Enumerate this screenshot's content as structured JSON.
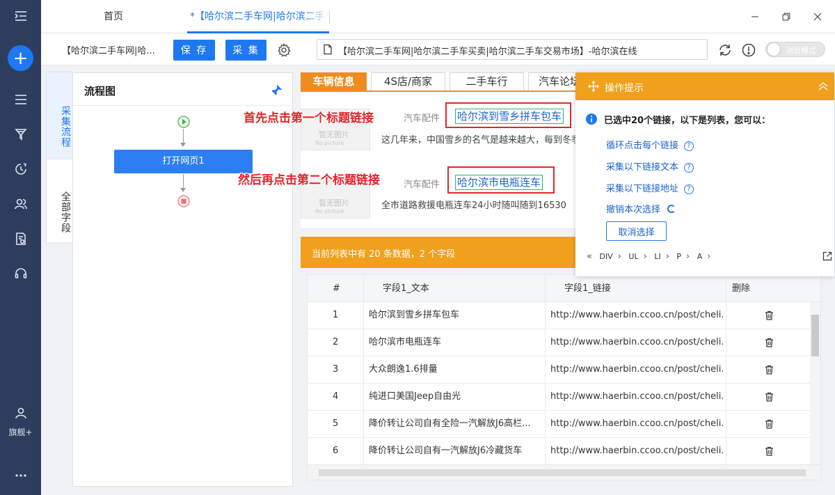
{
  "window": {
    "tabs": [
      {
        "label": "首页"
      },
      {
        "label": "*【哈尔滨二手车网|哈尔滨二手车买卖|哈尔滨二手车交易市场】-哈尔滨在线"
      }
    ]
  },
  "sidebar": {
    "user_label": "旗舰+",
    "icons": [
      "menu-collapse-icon",
      "add-icon",
      "list-icon",
      "funnel-icon",
      "clock-icon",
      "users-icon",
      "document-icon",
      "headset-icon",
      "user-icon",
      "more-icon"
    ]
  },
  "toolbar": {
    "task_name": "【哈尔滨二手车网|哈...",
    "save_label": "保 存",
    "collect_label": "采 集",
    "url": "【哈尔滨二手车网|哈尔滨二手车买卖|哈尔滨二手车交易市场】-哈尔滨在线",
    "browse_mode_label": "浏览模式"
  },
  "vtabs": {
    "flow": "采集流程",
    "fields": "全部字段"
  },
  "flowchart": {
    "title": "流程图",
    "node": "打开网页1"
  },
  "preview": {
    "site_tabs": [
      "车辆信息",
      "4S店/商家",
      "二手车行",
      "汽车论坛"
    ],
    "items": [
      {
        "category": "汽车配件",
        "title": "哈尔滨到雪乡拼车包车",
        "desc": "这几年来，中国雪乡的名气是越来越大，每到冬季"
      },
      {
        "category": "汽车配件",
        "title": "哈尔滨市电瓶连车",
        "desc": "全市道路救援电瓶连车24小时随叫随到16530"
      }
    ],
    "no_picture_cn": "暂无图片",
    "no_picture_en": "No picture",
    "callout_1": "首先点击第一个标题链接",
    "callout_2": "然后再点击第二个标题链接"
  },
  "data_summary": "当前列表中有 20 条数据，2 个字段",
  "table": {
    "headers": [
      "#",
      "字段1_文本",
      "字段1_链接",
      "删除"
    ],
    "rows": [
      {
        "n": "1",
        "text": "哈尔滨到雪乡拼车包车",
        "link": "http://www.haerbin.ccoo.cn/post/cheli..."
      },
      {
        "n": "2",
        "text": "哈尔滨市电瓶连车",
        "link": "http://www.haerbin.ccoo.cn/post/cheli..."
      },
      {
        "n": "3",
        "text": "大众朗逸1.6排量",
        "link": "http://www.haerbin.ccoo.cn/post/cheli..."
      },
      {
        "n": "4",
        "text": "纯进口美国Jeep自由光",
        "link": "http://www.haerbin.ccoo.cn/post/cheli..."
      },
      {
        "n": "5",
        "text": "降价转让公司自有全险一汽解放J6高栏...",
        "link": "http://www.haerbin.ccoo.cn/post/cheli..."
      },
      {
        "n": "6",
        "text": "降价转让公司自有一汽解放J6冷藏货车",
        "link": "http://www.haerbin.ccoo.cn/post/cheli..."
      }
    ]
  },
  "tips": {
    "title": "操作提示",
    "message": "已选中20个链接，以下是列表，您可以：",
    "options": [
      "循环点击每个链接",
      "采集以下链接文本",
      "采集以下链接地址",
      "撤销本次选择"
    ],
    "cancel_label": "取消选择",
    "breadcrumbs": [
      "DIV",
      "UL",
      "LI",
      "P",
      "A"
    ]
  },
  "colors": {
    "primary": "#1e78f0",
    "sidebar": "#2e3d5e",
    "accent_orange": "#f0a01c",
    "annotation_red": "#e0272a"
  }
}
